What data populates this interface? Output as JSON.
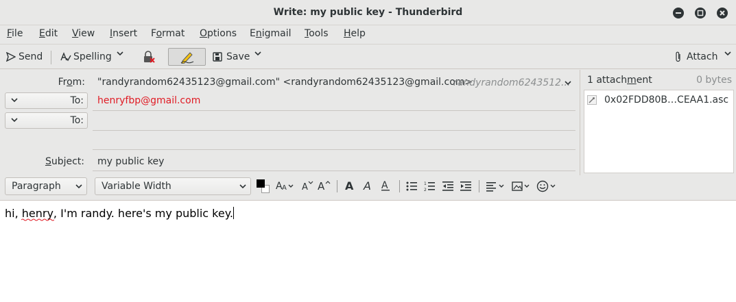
{
  "window": {
    "title": "Write: my public key - Thunderbird"
  },
  "menubar": {
    "items": [
      {
        "label": "File",
        "accel": "F",
        "rest": "ile"
      },
      {
        "label": "Edit",
        "accel": "E",
        "rest": "dit"
      },
      {
        "label": "View",
        "accel": "V",
        "rest": "iew"
      },
      {
        "label": "Insert",
        "accel": "I",
        "rest": "nsert"
      },
      {
        "label": "Format",
        "pre": "F",
        "accel": "o",
        "rest": "rmat"
      },
      {
        "label": "Options",
        "accel": "O",
        "rest": "ptions"
      },
      {
        "label": "Enigmail",
        "pre": "E",
        "accel": "n",
        "rest": "igmail"
      },
      {
        "label": "Tools",
        "accel": "T",
        "rest": "ools"
      },
      {
        "label": "Help",
        "accel": "H",
        "rest": "elp"
      }
    ]
  },
  "toolbar": {
    "send_label": "Send",
    "spelling_label": "Spelling",
    "save_label": "Save",
    "attach_label": "Attach"
  },
  "header": {
    "from_label": "From:",
    "from_value": "\"randyrandom62435123@gmail.com\" <randyrandom62435123@gmail.com>",
    "from_identity": "randyrandom6243512...",
    "to_label": "To:",
    "to_value": "henryfbp@gmail.com",
    "to2_label": "To:",
    "to2_value": "",
    "subject_label": "Subject:",
    "subject_value": "my public key"
  },
  "attachments": {
    "count_label": "1 attachment",
    "size_label": "0 bytes",
    "items": [
      {
        "name": "0x02FDD80B…CEAA1.asc"
      }
    ]
  },
  "format_toolbar": {
    "paragraph_value": "Paragraph",
    "font_value": "Variable Width"
  },
  "body": {
    "text": "hi, henry, I'm randy. here's my public key."
  },
  "colors": {
    "recipient": "#e01b24",
    "window_bg": "#e8e8e7",
    "text": "#2e3436"
  }
}
